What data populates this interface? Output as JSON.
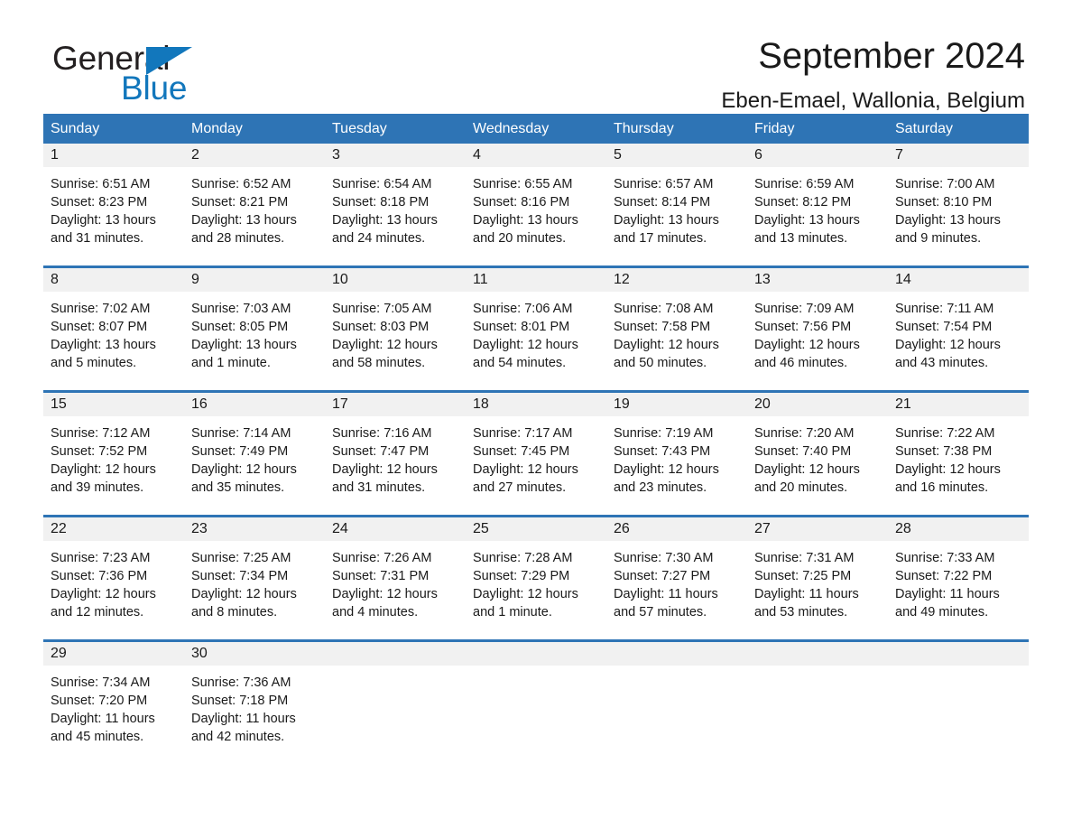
{
  "brand": {
    "name_part1": "General",
    "name_part2": "Blue",
    "triangle_icon": "triangle-icon",
    "accent_color": "#1277bc"
  },
  "header": {
    "title": "September 2024",
    "subtitle": "Eben-Emael, Wallonia, Belgium"
  },
  "colors": {
    "header_blue": "#2e74b5",
    "daynum_band": "#f1f1f1",
    "text": "#1a1a1a"
  },
  "weekdays": [
    "Sunday",
    "Monday",
    "Tuesday",
    "Wednesday",
    "Thursday",
    "Friday",
    "Saturday"
  ],
  "weeks": [
    {
      "days": [
        {
          "num": "1",
          "sunrise": "Sunrise: 6:51 AM",
          "sunset": "Sunset: 8:23 PM",
          "daylight_line1": "Daylight: 13 hours",
          "daylight_line2": "and 31 minutes."
        },
        {
          "num": "2",
          "sunrise": "Sunrise: 6:52 AM",
          "sunset": "Sunset: 8:21 PM",
          "daylight_line1": "Daylight: 13 hours",
          "daylight_line2": "and 28 minutes."
        },
        {
          "num": "3",
          "sunrise": "Sunrise: 6:54 AM",
          "sunset": "Sunset: 8:18 PM",
          "daylight_line1": "Daylight: 13 hours",
          "daylight_line2": "and 24 minutes."
        },
        {
          "num": "4",
          "sunrise": "Sunrise: 6:55 AM",
          "sunset": "Sunset: 8:16 PM",
          "daylight_line1": "Daylight: 13 hours",
          "daylight_line2": "and 20 minutes."
        },
        {
          "num": "5",
          "sunrise": "Sunrise: 6:57 AM",
          "sunset": "Sunset: 8:14 PM",
          "daylight_line1": "Daylight: 13 hours",
          "daylight_line2": "and 17 minutes."
        },
        {
          "num": "6",
          "sunrise": "Sunrise: 6:59 AM",
          "sunset": "Sunset: 8:12 PM",
          "daylight_line1": "Daylight: 13 hours",
          "daylight_line2": "and 13 minutes."
        },
        {
          "num": "7",
          "sunrise": "Sunrise: 7:00 AM",
          "sunset": "Sunset: 8:10 PM",
          "daylight_line1": "Daylight: 13 hours",
          "daylight_line2": "and 9 minutes."
        }
      ]
    },
    {
      "days": [
        {
          "num": "8",
          "sunrise": "Sunrise: 7:02 AM",
          "sunset": "Sunset: 8:07 PM",
          "daylight_line1": "Daylight: 13 hours",
          "daylight_line2": "and 5 minutes."
        },
        {
          "num": "9",
          "sunrise": "Sunrise: 7:03 AM",
          "sunset": "Sunset: 8:05 PM",
          "daylight_line1": "Daylight: 13 hours",
          "daylight_line2": "and 1 minute."
        },
        {
          "num": "10",
          "sunrise": "Sunrise: 7:05 AM",
          "sunset": "Sunset: 8:03 PM",
          "daylight_line1": "Daylight: 12 hours",
          "daylight_line2": "and 58 minutes."
        },
        {
          "num": "11",
          "sunrise": "Sunrise: 7:06 AM",
          "sunset": "Sunset: 8:01 PM",
          "daylight_line1": "Daylight: 12 hours",
          "daylight_line2": "and 54 minutes."
        },
        {
          "num": "12",
          "sunrise": "Sunrise: 7:08 AM",
          "sunset": "Sunset: 7:58 PM",
          "daylight_line1": "Daylight: 12 hours",
          "daylight_line2": "and 50 minutes."
        },
        {
          "num": "13",
          "sunrise": "Sunrise: 7:09 AM",
          "sunset": "Sunset: 7:56 PM",
          "daylight_line1": "Daylight: 12 hours",
          "daylight_line2": "and 46 minutes."
        },
        {
          "num": "14",
          "sunrise": "Sunrise: 7:11 AM",
          "sunset": "Sunset: 7:54 PM",
          "daylight_line1": "Daylight: 12 hours",
          "daylight_line2": "and 43 minutes."
        }
      ]
    },
    {
      "days": [
        {
          "num": "15",
          "sunrise": "Sunrise: 7:12 AM",
          "sunset": "Sunset: 7:52 PM",
          "daylight_line1": "Daylight: 12 hours",
          "daylight_line2": "and 39 minutes."
        },
        {
          "num": "16",
          "sunrise": "Sunrise: 7:14 AM",
          "sunset": "Sunset: 7:49 PM",
          "daylight_line1": "Daylight: 12 hours",
          "daylight_line2": "and 35 minutes."
        },
        {
          "num": "17",
          "sunrise": "Sunrise: 7:16 AM",
          "sunset": "Sunset: 7:47 PM",
          "daylight_line1": "Daylight: 12 hours",
          "daylight_line2": "and 31 minutes."
        },
        {
          "num": "18",
          "sunrise": "Sunrise: 7:17 AM",
          "sunset": "Sunset: 7:45 PM",
          "daylight_line1": "Daylight: 12 hours",
          "daylight_line2": "and 27 minutes."
        },
        {
          "num": "19",
          "sunrise": "Sunrise: 7:19 AM",
          "sunset": "Sunset: 7:43 PM",
          "daylight_line1": "Daylight: 12 hours",
          "daylight_line2": "and 23 minutes."
        },
        {
          "num": "20",
          "sunrise": "Sunrise: 7:20 AM",
          "sunset": "Sunset: 7:40 PM",
          "daylight_line1": "Daylight: 12 hours",
          "daylight_line2": "and 20 minutes."
        },
        {
          "num": "21",
          "sunrise": "Sunrise: 7:22 AM",
          "sunset": "Sunset: 7:38 PM",
          "daylight_line1": "Daylight: 12 hours",
          "daylight_line2": "and 16 minutes."
        }
      ]
    },
    {
      "days": [
        {
          "num": "22",
          "sunrise": "Sunrise: 7:23 AM",
          "sunset": "Sunset: 7:36 PM",
          "daylight_line1": "Daylight: 12 hours",
          "daylight_line2": "and 12 minutes."
        },
        {
          "num": "23",
          "sunrise": "Sunrise: 7:25 AM",
          "sunset": "Sunset: 7:34 PM",
          "daylight_line1": "Daylight: 12 hours",
          "daylight_line2": "and 8 minutes."
        },
        {
          "num": "24",
          "sunrise": "Sunrise: 7:26 AM",
          "sunset": "Sunset: 7:31 PM",
          "daylight_line1": "Daylight: 12 hours",
          "daylight_line2": "and 4 minutes."
        },
        {
          "num": "25",
          "sunrise": "Sunrise: 7:28 AM",
          "sunset": "Sunset: 7:29 PM",
          "daylight_line1": "Daylight: 12 hours",
          "daylight_line2": "and 1 minute."
        },
        {
          "num": "26",
          "sunrise": "Sunrise: 7:30 AM",
          "sunset": "Sunset: 7:27 PM",
          "daylight_line1": "Daylight: 11 hours",
          "daylight_line2": "and 57 minutes."
        },
        {
          "num": "27",
          "sunrise": "Sunrise: 7:31 AM",
          "sunset": "Sunset: 7:25 PM",
          "daylight_line1": "Daylight: 11 hours",
          "daylight_line2": "and 53 minutes."
        },
        {
          "num": "28",
          "sunrise": "Sunrise: 7:33 AM",
          "sunset": "Sunset: 7:22 PM",
          "daylight_line1": "Daylight: 11 hours",
          "daylight_line2": "and 49 minutes."
        }
      ]
    },
    {
      "days": [
        {
          "num": "29",
          "sunrise": "Sunrise: 7:34 AM",
          "sunset": "Sunset: 7:20 PM",
          "daylight_line1": "Daylight: 11 hours",
          "daylight_line2": "and 45 minutes."
        },
        {
          "num": "30",
          "sunrise": "Sunrise: 7:36 AM",
          "sunset": "Sunset: 7:18 PM",
          "daylight_line1": "Daylight: 11 hours",
          "daylight_line2": "and 42 minutes."
        },
        {
          "num": "",
          "sunrise": "",
          "sunset": "",
          "daylight_line1": "",
          "daylight_line2": ""
        },
        {
          "num": "",
          "sunrise": "",
          "sunset": "",
          "daylight_line1": "",
          "daylight_line2": ""
        },
        {
          "num": "",
          "sunrise": "",
          "sunset": "",
          "daylight_line1": "",
          "daylight_line2": ""
        },
        {
          "num": "",
          "sunrise": "",
          "sunset": "",
          "daylight_line1": "",
          "daylight_line2": ""
        },
        {
          "num": "",
          "sunrise": "",
          "sunset": "",
          "daylight_line1": "",
          "daylight_line2": ""
        }
      ]
    }
  ]
}
